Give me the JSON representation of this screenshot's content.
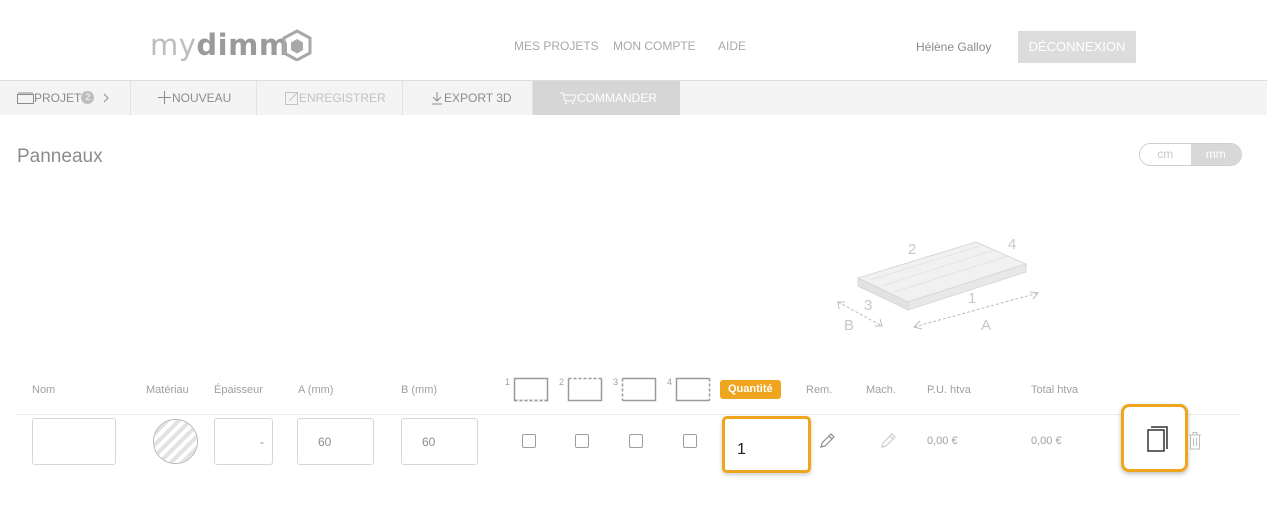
{
  "brand": {
    "logo_light": "my",
    "logo_bold": "dimm"
  },
  "nav": {
    "projects": "MES PROJETS",
    "account": "MON COMPTE",
    "help": "AIDE"
  },
  "user": {
    "name": "Hélène Galloy",
    "logout_label": "DÉCONNEXION"
  },
  "toolbar": {
    "project_label": "PROJET",
    "project_count": "2",
    "new_label": "NOUVEAU",
    "save_label": "ENREGISTRER",
    "export_label": "EXPORT 3D",
    "order_label": "COMMANDER"
  },
  "page": {
    "title": "Panneaux"
  },
  "units": {
    "cm": "cm",
    "mm": "mm",
    "selected": "mm"
  },
  "diagram": {
    "edge1": "1",
    "edge2": "2",
    "edge3": "3",
    "edge4": "4",
    "dim_a": "A",
    "dim_b": "B"
  },
  "table": {
    "headers": {
      "name": "Nom",
      "material": "Matériau",
      "thickness": "Épaisseur",
      "a": "A (mm)",
      "b": "B (mm)",
      "edge1": "1",
      "edge2": "2",
      "edge3": "3",
      "edge4": "4",
      "quantity": "Quantité",
      "rem": "Rem.",
      "mach": "Mach.",
      "unit_price": "P.U. htva",
      "total": "Total htva"
    },
    "row": {
      "name": "",
      "thickness": "-",
      "a": "60",
      "b": "60",
      "quantity": "1",
      "unit_price": "0,00 €",
      "total": "0,00 €"
    }
  },
  "colors": {
    "accent": "#f0a51e",
    "muted": "#a0a0a0",
    "toolbar_bg": "#f4f4f4"
  }
}
